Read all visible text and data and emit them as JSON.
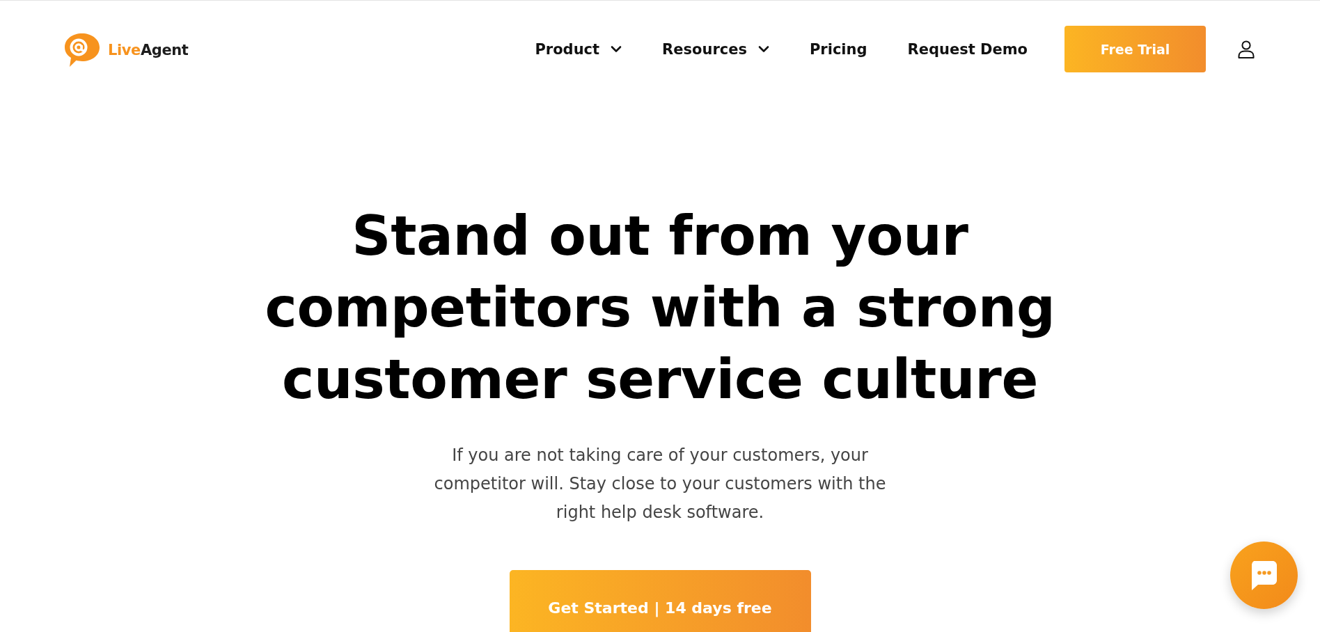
{
  "header": {
    "logo": {
      "parts": [
        {
          "text": "Live",
          "kind": "accent"
        },
        {
          "text": "Agent",
          "kind": "plain"
        }
      ]
    },
    "nav": [
      {
        "label": "Product",
        "dropdown": true
      },
      {
        "label": "Resources",
        "dropdown": true
      },
      {
        "label": "Pricing",
        "dropdown": false
      },
      {
        "label": "Request Demo",
        "dropdown": false
      }
    ],
    "cta": {
      "label": "Free Trial"
    }
  },
  "hero": {
    "headline": "Stand out from your competitors with a strong customer service culture",
    "subtext": "If you are not taking care of your customers, your competitor will. Stay close to your customers with the right help desk software.",
    "button": {
      "label": "Get Started | 14 days free"
    }
  }
}
